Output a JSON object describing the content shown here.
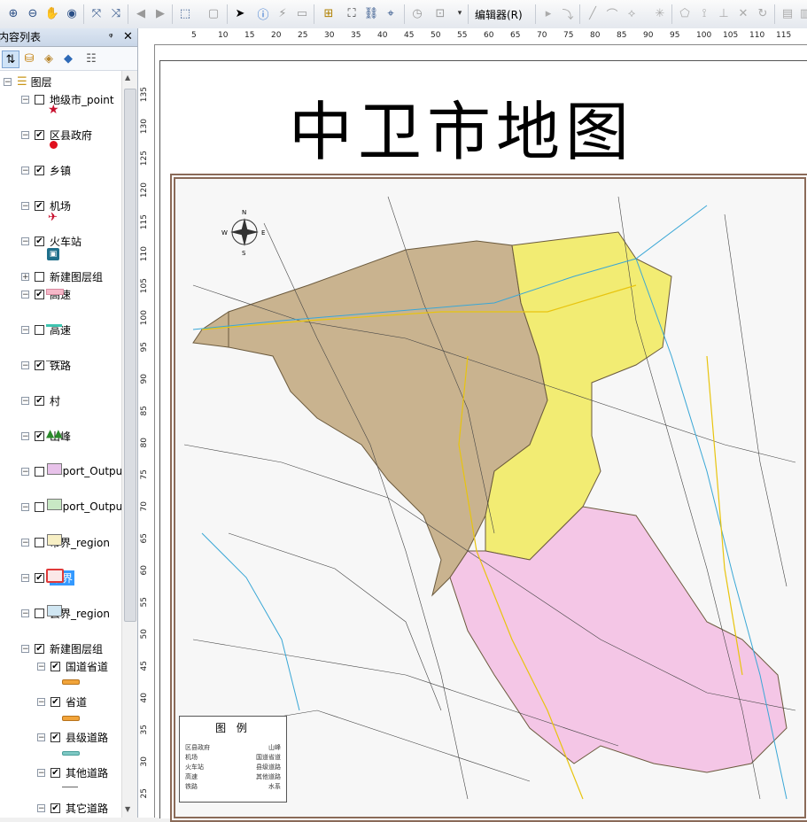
{
  "toolbar": {
    "editor_label": "编辑器(R)"
  },
  "toc": {
    "title": "内容列表",
    "pin": "ᵠ",
    "close": "✕",
    "root_label": "图层",
    "layers": [
      {
        "label": "地级市_point",
        "checked": false
      },
      {
        "label": "区县政府",
        "checked": true
      },
      {
        "label": "乡镇",
        "checked": true
      },
      {
        "label": "机场",
        "checked": true
      },
      {
        "label": "火车站",
        "checked": true
      },
      {
        "label": "新建图层组",
        "checked": false
      },
      {
        "label": "高速",
        "checked": true
      },
      {
        "label": "高速",
        "checked": false
      },
      {
        "label": "铁路",
        "checked": true
      },
      {
        "label": "村",
        "checked": true
      },
      {
        "label": "山峰",
        "checked": true
      },
      {
        "label": "Export_Outpu",
        "checked": false
      },
      {
        "label": "Export_Outpu",
        "checked": false
      },
      {
        "label": "市界_region",
        "checked": false
      },
      {
        "label": "市界",
        "checked": true
      },
      {
        "label": "县界_region",
        "checked": false
      },
      {
        "label": "新建图层组",
        "checked": true
      },
      {
        "label": "国道省道",
        "checked": true
      },
      {
        "label": "省道",
        "checked": true
      },
      {
        "label": "县级道路",
        "checked": true
      },
      {
        "label": "其他道路",
        "checked": true
      },
      {
        "label": "其它道路",
        "checked": true
      }
    ]
  },
  "ruler": {
    "top": [
      "5",
      "10",
      "15",
      "20",
      "25",
      "30",
      "35",
      "40",
      "45",
      "50",
      "55",
      "60",
      "65",
      "70",
      "75",
      "80",
      "85",
      "90",
      "95",
      "100",
      "105",
      "110",
      "115"
    ],
    "left": [
      "135",
      "130",
      "125",
      "120",
      "115",
      "110",
      "105",
      "100",
      "95",
      "90",
      "85",
      "80",
      "75",
      "70",
      "65",
      "60",
      "55",
      "50",
      "45",
      "40",
      "35",
      "30",
      "25"
    ]
  },
  "map": {
    "title": "中卫市地图",
    "legend_title": "图 例",
    "legend_items": [
      [
        "区县政府",
        "山峰"
      ],
      [
        "机场",
        "国道省道"
      ],
      [
        "火车站",
        "县级道路"
      ],
      [
        "高速",
        "其他道路"
      ],
      [
        "铁路",
        "水系"
      ]
    ],
    "compass": [
      "N",
      "S",
      "W",
      "E"
    ]
  }
}
